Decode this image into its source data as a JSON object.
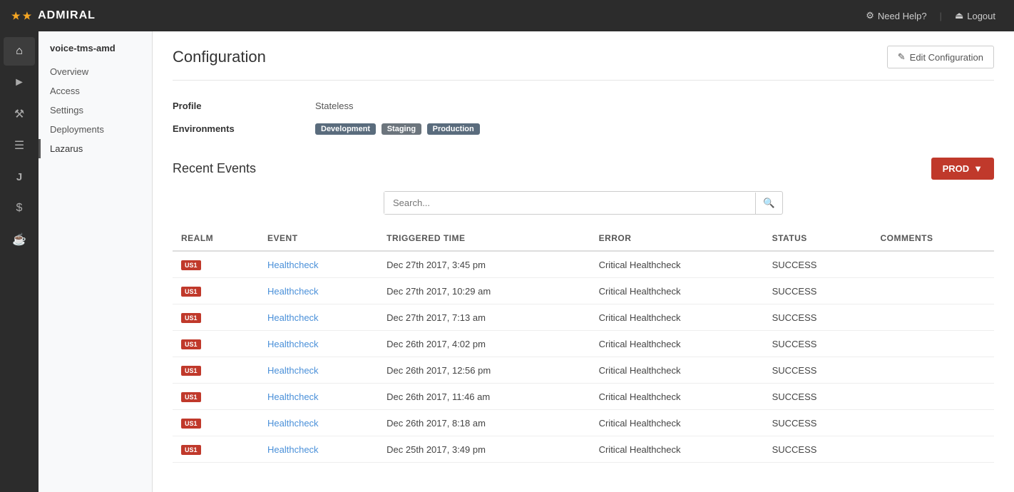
{
  "app": {
    "name": "ADMIRAL",
    "stars": [
      "★",
      "★"
    ]
  },
  "topnav": {
    "help_label": "Need Help?",
    "logout_label": "Logout"
  },
  "sidebar": {
    "project_name": "voice-tms-amd",
    "nav_items": [
      {
        "id": "overview",
        "label": "Overview",
        "active": false
      },
      {
        "id": "access",
        "label": "Access",
        "active": false
      },
      {
        "id": "settings",
        "label": "Settings",
        "active": false
      },
      {
        "id": "deployments",
        "label": "Deployments",
        "active": false
      },
      {
        "id": "lazarus",
        "label": "Lazarus",
        "active": true
      }
    ]
  },
  "icon_rail": [
    {
      "id": "home",
      "icon": "⌂",
      "active": true
    },
    {
      "id": "rocket",
      "icon": "🚀",
      "active": false
    },
    {
      "id": "briefcase",
      "icon": "💼",
      "active": false
    },
    {
      "id": "document",
      "icon": "📄",
      "active": false
    },
    {
      "id": "letter-j",
      "icon": "J",
      "active": false
    },
    {
      "id": "dollar",
      "icon": "$",
      "active": false
    },
    {
      "id": "bag",
      "icon": "🛍",
      "active": false
    }
  ],
  "config": {
    "title": "Configuration",
    "edit_button_label": "Edit Configuration",
    "edit_icon": "✎",
    "profile_label": "Profile",
    "profile_value": "Stateless",
    "environments_label": "Environments",
    "environments": [
      {
        "name": "Development",
        "class": "development"
      },
      {
        "name": "Staging",
        "class": "staging"
      },
      {
        "name": "Production",
        "class": "production"
      }
    ]
  },
  "recent_events": {
    "title": "Recent Events",
    "prod_button": "PROD",
    "search_placeholder": "Search...",
    "columns": [
      "REALM",
      "EVENT",
      "TRIGGERED TIME",
      "ERROR",
      "STATUS",
      "COMMENTS"
    ],
    "rows": [
      {
        "realm": "US1",
        "event": "Healthcheck",
        "triggered_time": "Dec 27th 2017, 3:45 pm",
        "error": "Critical Healthcheck",
        "status": "SUCCESS",
        "comments": ""
      },
      {
        "realm": "US1",
        "event": "Healthcheck",
        "triggered_time": "Dec 27th 2017, 10:29 am",
        "error": "Critical Healthcheck",
        "status": "SUCCESS",
        "comments": ""
      },
      {
        "realm": "US1",
        "event": "Healthcheck",
        "triggered_time": "Dec 27th 2017, 7:13 am",
        "error": "Critical Healthcheck",
        "status": "SUCCESS",
        "comments": ""
      },
      {
        "realm": "US1",
        "event": "Healthcheck",
        "triggered_time": "Dec 26th 2017, 4:02 pm",
        "error": "Critical Healthcheck",
        "status": "SUCCESS",
        "comments": ""
      },
      {
        "realm": "US1",
        "event": "Healthcheck",
        "triggered_time": "Dec 26th 2017, 12:56 pm",
        "error": "Critical Healthcheck",
        "status": "SUCCESS",
        "comments": ""
      },
      {
        "realm": "US1",
        "event": "Healthcheck",
        "triggered_time": "Dec 26th 2017, 11:46 am",
        "error": "Critical Healthcheck",
        "status": "SUCCESS",
        "comments": ""
      },
      {
        "realm": "US1",
        "event": "Healthcheck",
        "triggered_time": "Dec 26th 2017, 8:18 am",
        "error": "Critical Healthcheck",
        "status": "SUCCESS",
        "comments": ""
      },
      {
        "realm": "US1",
        "event": "Healthcheck",
        "triggered_time": "Dec 25th 2017, 3:49 pm",
        "error": "Critical Healthcheck",
        "status": "SUCCESS",
        "comments": ""
      }
    ]
  }
}
